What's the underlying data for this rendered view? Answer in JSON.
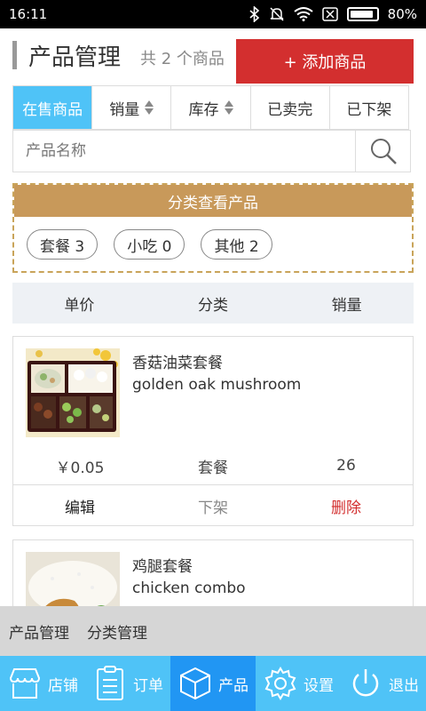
{
  "status_bar": {
    "time": "16:11",
    "battery": "80%",
    "battery_level": 0.8
  },
  "header": {
    "title": "产品管理",
    "count_text": "共 2 个商品",
    "add_button": "+ 添加商品"
  },
  "tabs": [
    {
      "label": "在售商品",
      "active": true,
      "sortable": false
    },
    {
      "label": "销量",
      "active": false,
      "sortable": true
    },
    {
      "label": "库存",
      "active": false,
      "sortable": true
    },
    {
      "label": "已卖完",
      "active": false,
      "sortable": false
    },
    {
      "label": "已下架",
      "active": false,
      "sortable": false
    }
  ],
  "search": {
    "placeholder": "产品名称",
    "value": ""
  },
  "category": {
    "heading": "分类查看产品",
    "chips": [
      "套餐 3",
      "小吃 0",
      "其他 2"
    ]
  },
  "columns": [
    "单价",
    "分类",
    "销量"
  ],
  "products": [
    {
      "name": "香菇油菜套餐",
      "subtitle": "golden oak mushroom",
      "price": "￥0.05",
      "category": "套餐",
      "sales": "26",
      "actions": {
        "edit": "编辑",
        "offshelf": "下架",
        "delete": "删除"
      }
    },
    {
      "name": "鸡腿套餐",
      "subtitle": "chicken combo"
    }
  ],
  "submenu": [
    "产品管理",
    "分类管理"
  ],
  "bottom_nav": [
    {
      "label": "店铺",
      "icon": "store-icon",
      "active": false
    },
    {
      "label": "订单",
      "icon": "order-list-icon",
      "active": false
    },
    {
      "label": "产品",
      "icon": "box-icon",
      "active": true
    },
    {
      "label": "设置",
      "icon": "gear-icon",
      "active": false
    },
    {
      "label": "退出",
      "icon": "power-icon",
      "active": false
    }
  ],
  "colors": {
    "accent_blue": "#4fc3f7",
    "active_blue": "#2196f3",
    "add_red": "#d32f2f",
    "category_gold": "#c8995a"
  }
}
